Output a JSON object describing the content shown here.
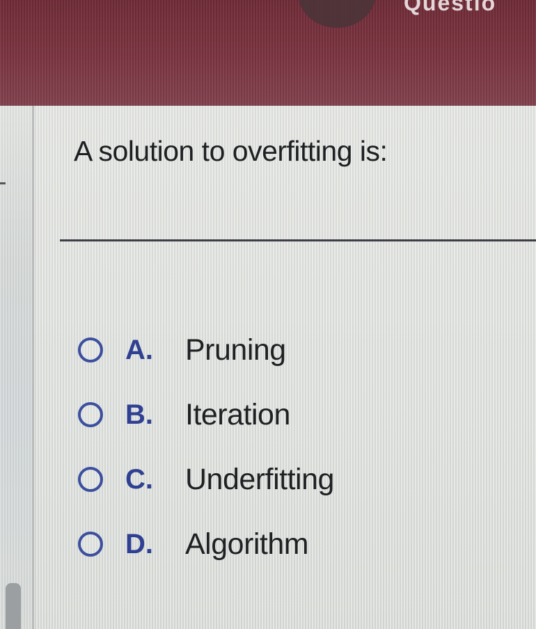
{
  "header": {
    "left_text": "",
    "right_text": "Questio"
  },
  "question": {
    "text": "A solution to overfitting is:"
  },
  "choices": [
    {
      "letter": "A.",
      "text": "Pruning"
    },
    {
      "letter": "B.",
      "text": "Iteration"
    },
    {
      "letter": "C.",
      "text": "Underfitting"
    },
    {
      "letter": "D.",
      "text": "Algorithm"
    }
  ],
  "colors": {
    "header": "#7a3340",
    "radio": "#3c4f9e",
    "letter": "#2f3f92",
    "text": "#1e1f22"
  }
}
